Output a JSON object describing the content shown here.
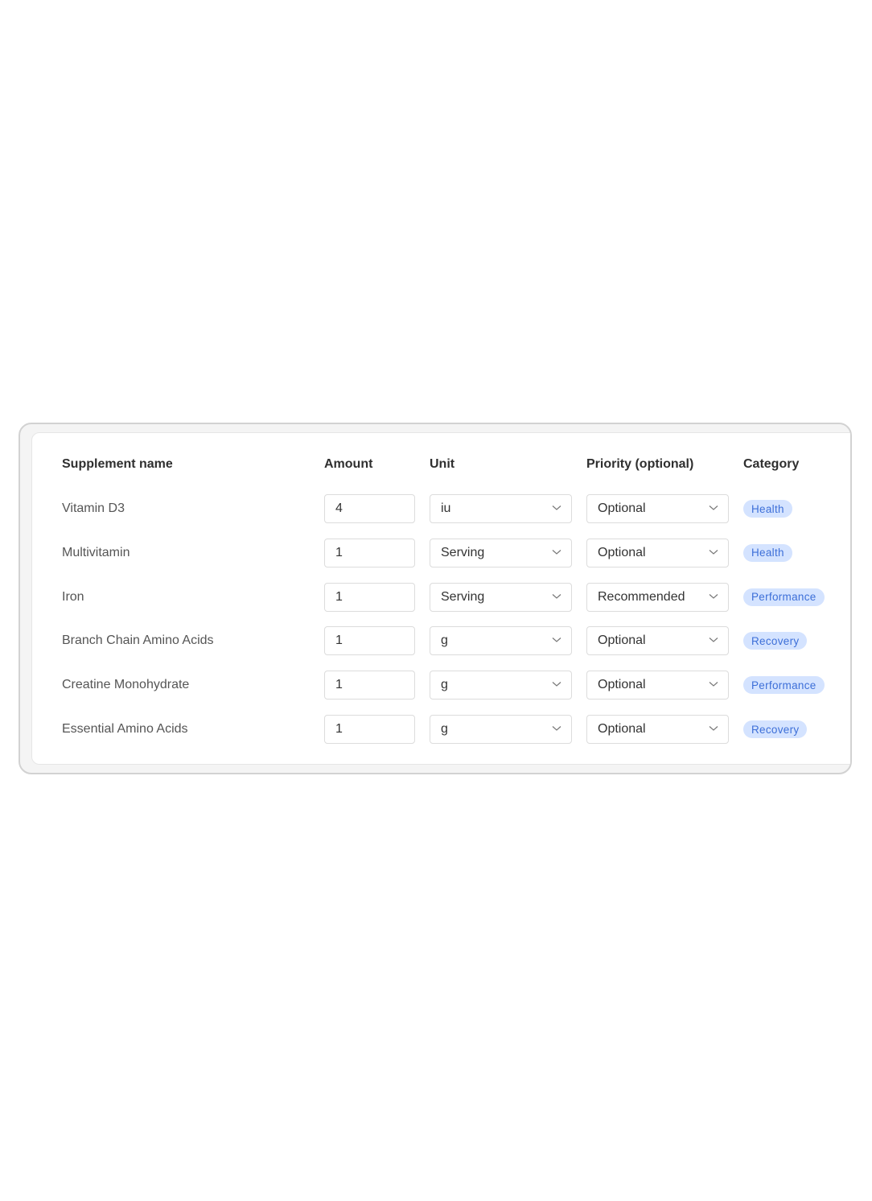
{
  "table": {
    "headers": {
      "name": "Supplement name",
      "amount": "Amount",
      "unit": "Unit",
      "priority": "Priority (optional)",
      "category": "Category"
    },
    "rows": [
      {
        "name": "Vitamin D3",
        "amount": "4",
        "unit": "iu",
        "priority": "Optional",
        "category": "Health"
      },
      {
        "name": "Multivitamin",
        "amount": "1",
        "unit": "Serving",
        "priority": "Optional",
        "category": "Health"
      },
      {
        "name": "Iron",
        "amount": "1",
        "unit": "Serving",
        "priority": "Recommended",
        "category": "Performance"
      },
      {
        "name": "Branch Chain Amino Acids",
        "amount": "1",
        "unit": "g",
        "priority": "Optional",
        "category": "Recovery"
      },
      {
        "name": "Creatine Monohydrate",
        "amount": "1",
        "unit": "g",
        "priority": "Optional",
        "category": "Performance"
      },
      {
        "name": "Essential Amino Acids",
        "amount": "1",
        "unit": "g",
        "priority": "Optional",
        "category": "Recovery"
      }
    ]
  },
  "icons": {
    "dropdown": "chevron-down-icon"
  },
  "colors": {
    "badge_bg": "#d4e3ff",
    "badge_text": "#3d6fd8"
  }
}
